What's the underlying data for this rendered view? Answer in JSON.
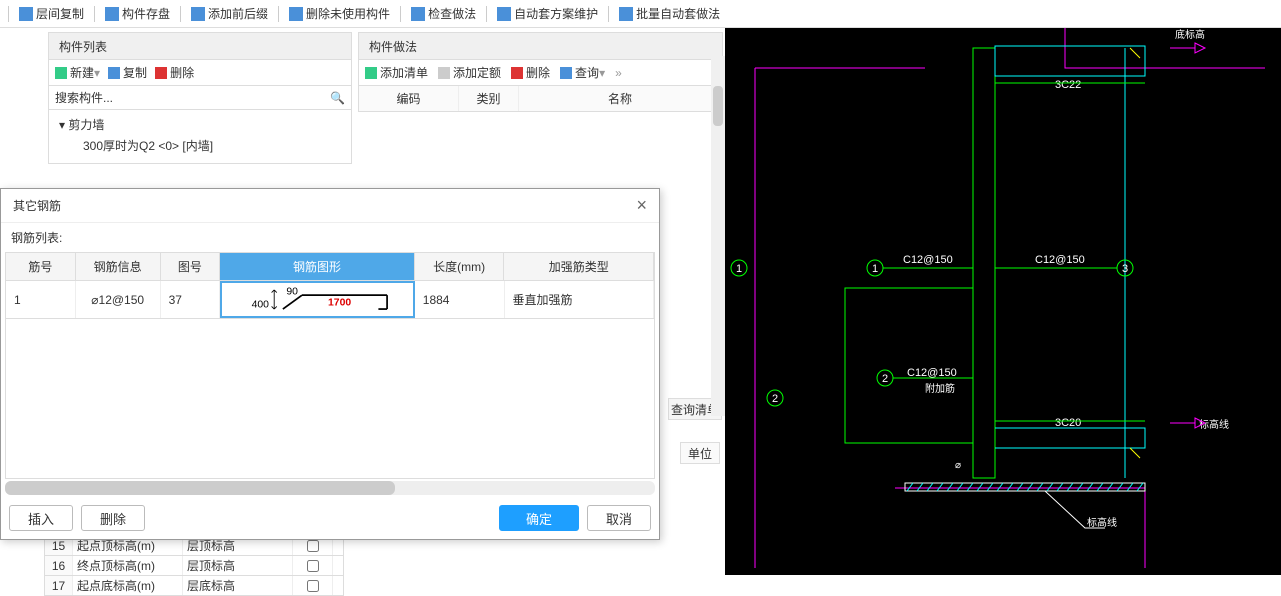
{
  "toolbar": {
    "btns": [
      "层间复制",
      "构件存盘",
      "添加前后缀",
      "删除未使用构件",
      "检查做法",
      "自动套方案维护",
      "批量自动套做法"
    ]
  },
  "listPanel": {
    "title": "构件列表",
    "new": "新建",
    "copy": "复制",
    "delete": "删除",
    "searchPlaceholder": "搜索构件...",
    "treeRoot": "剪力墙",
    "treeChild": "300厚时为Q2 <0> [内墙]"
  },
  "methodPanel": {
    "title": "构件做法",
    "addList": "添加清单",
    "addQuota": "添加定额",
    "delete": "删除",
    "query": "查询",
    "cols": [
      "编码",
      "类别",
      "名称"
    ],
    "queryList": "查询清单",
    "unit": "单位"
  },
  "dialog": {
    "title": "其它钢筋",
    "subtitle": "钢筋列表:",
    "headers": [
      "筋号",
      "钢筋信息",
      "图号",
      "钢筋图形",
      "长度(mm)",
      "加强筋类型"
    ],
    "row": {
      "jh": "1",
      "info": "⌀12@150",
      "tuhao": "37",
      "shape": {
        "h": "400",
        "angle": "90",
        "len": "1700"
      },
      "length": "1884",
      "type": "垂直加强筋"
    },
    "btnInsert": "插入",
    "btnDelete": "删除",
    "btnOk": "确定",
    "btnCancel": "取消"
  },
  "lowerGrid": [
    {
      "n": "15",
      "a": "起点顶标高(m)",
      "b": "层顶标高"
    },
    {
      "n": "16",
      "a": "终点顶标高(m)",
      "b": "层顶标高"
    },
    {
      "n": "17",
      "a": "起点底标高(m)",
      "b": "层底标高"
    }
  ],
  "cad": {
    "labels": {
      "top_right": "底标高",
      "l1": "3C22",
      "l2": "C12@150",
      "l3": "C12@150",
      "l4": "C12@150",
      "l5": "附加筋",
      "l6": "3C20",
      "mid_right": "标高线",
      "btm": "标高线"
    }
  }
}
